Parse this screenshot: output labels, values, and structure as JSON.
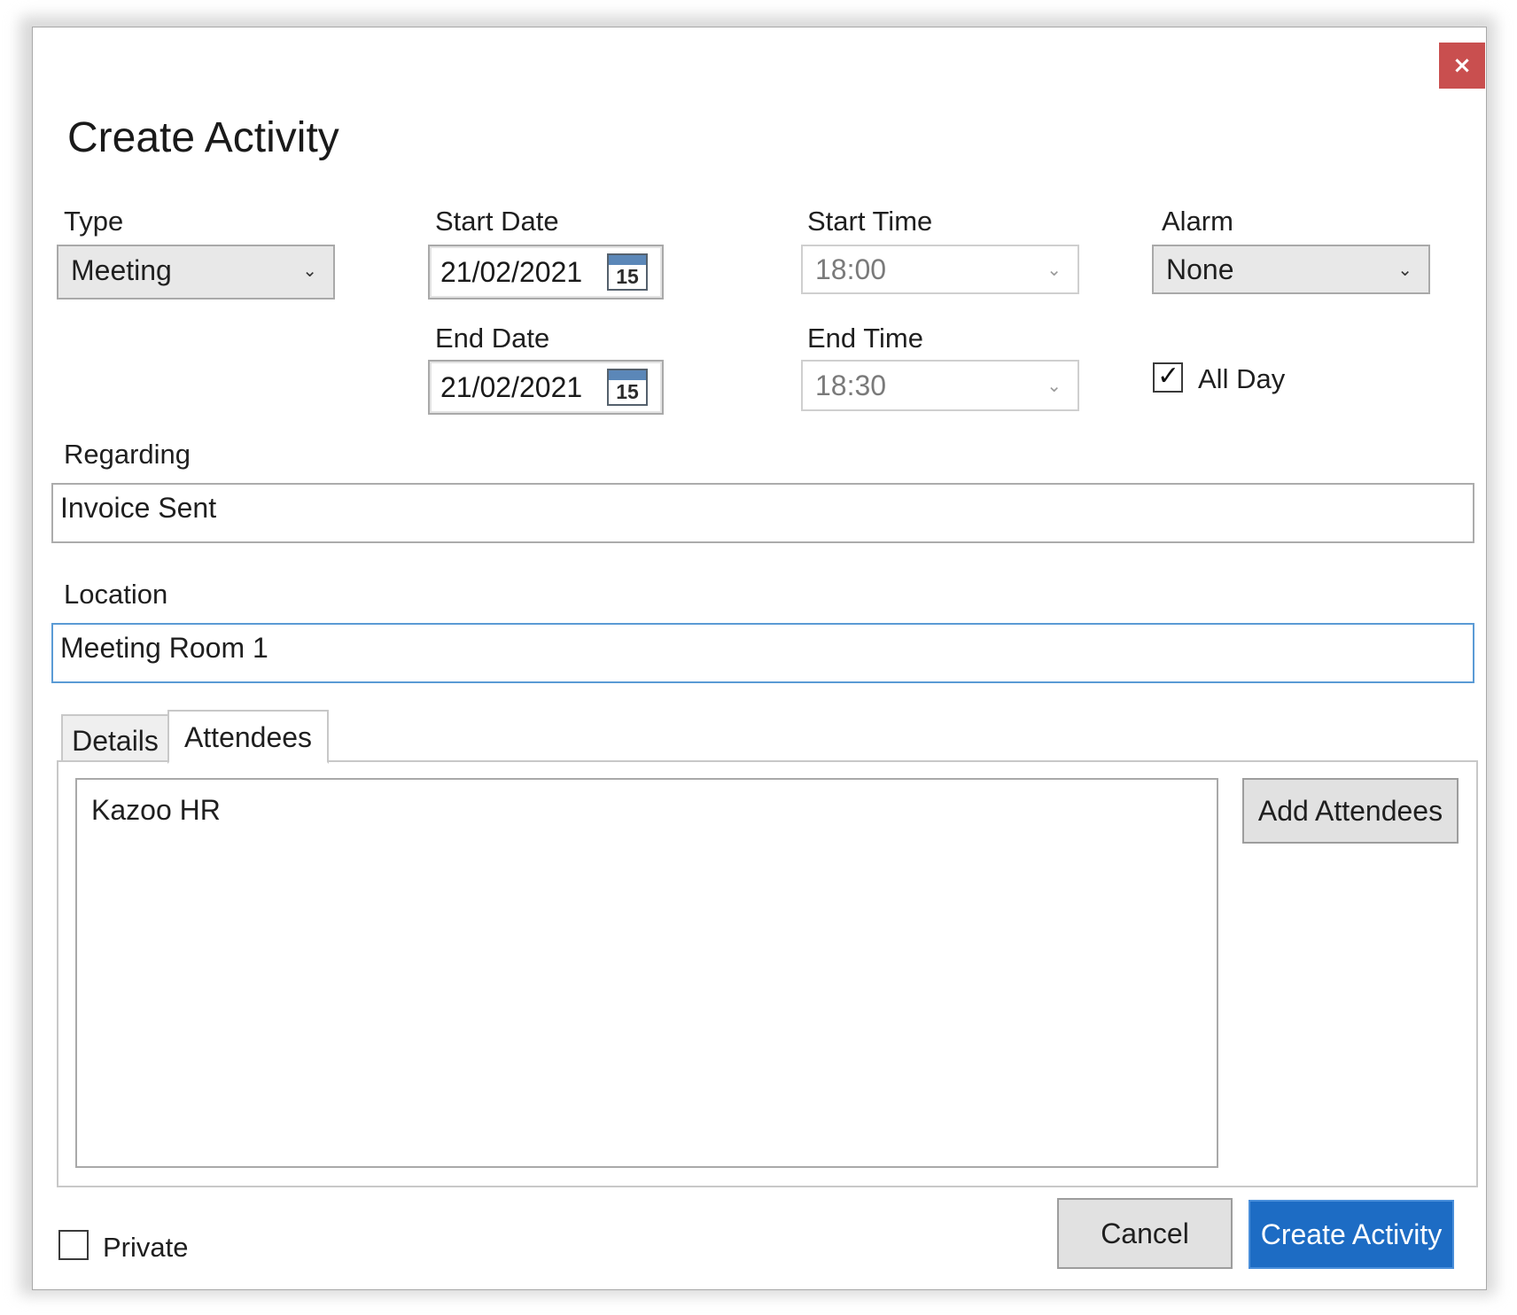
{
  "dialog": {
    "title": "Create Activity",
    "close_glyph": "×"
  },
  "type": {
    "label": "Type",
    "value": "Meeting"
  },
  "start_date": {
    "label": "Start Date",
    "value": "21/02/2021",
    "calendar_day": "15"
  },
  "end_date": {
    "label": "End Date",
    "value": "21/02/2021",
    "calendar_day": "15"
  },
  "start_time": {
    "label": "Start Time",
    "value": "18:00"
  },
  "end_time": {
    "label": "End Time",
    "value": "18:30"
  },
  "alarm": {
    "label": "Alarm",
    "value": "None"
  },
  "all_day": {
    "label": "All Day",
    "checked": true
  },
  "regarding": {
    "label": "Regarding",
    "value": "Invoice Sent"
  },
  "location": {
    "label": "Location",
    "value": "Meeting Room 1"
  },
  "tabs": [
    {
      "label": "Details",
      "active": false
    },
    {
      "label": "Attendees",
      "active": true
    }
  ],
  "attendees": {
    "items": [
      "Kazoo HR"
    ],
    "add_label": "Add Attendees"
  },
  "private": {
    "label": "Private",
    "checked": false
  },
  "actions": {
    "cancel_label": "Cancel",
    "create_label": "Create Activity"
  },
  "icons": {
    "close": "close-icon",
    "dropdown": "chevron-down-icon",
    "calendar": "calendar-icon",
    "check": "checkmark-icon"
  },
  "colors": {
    "close_button": "#c94f4f",
    "primary_button": "#1d6cc4",
    "focus_border": "#5b9bd5"
  }
}
